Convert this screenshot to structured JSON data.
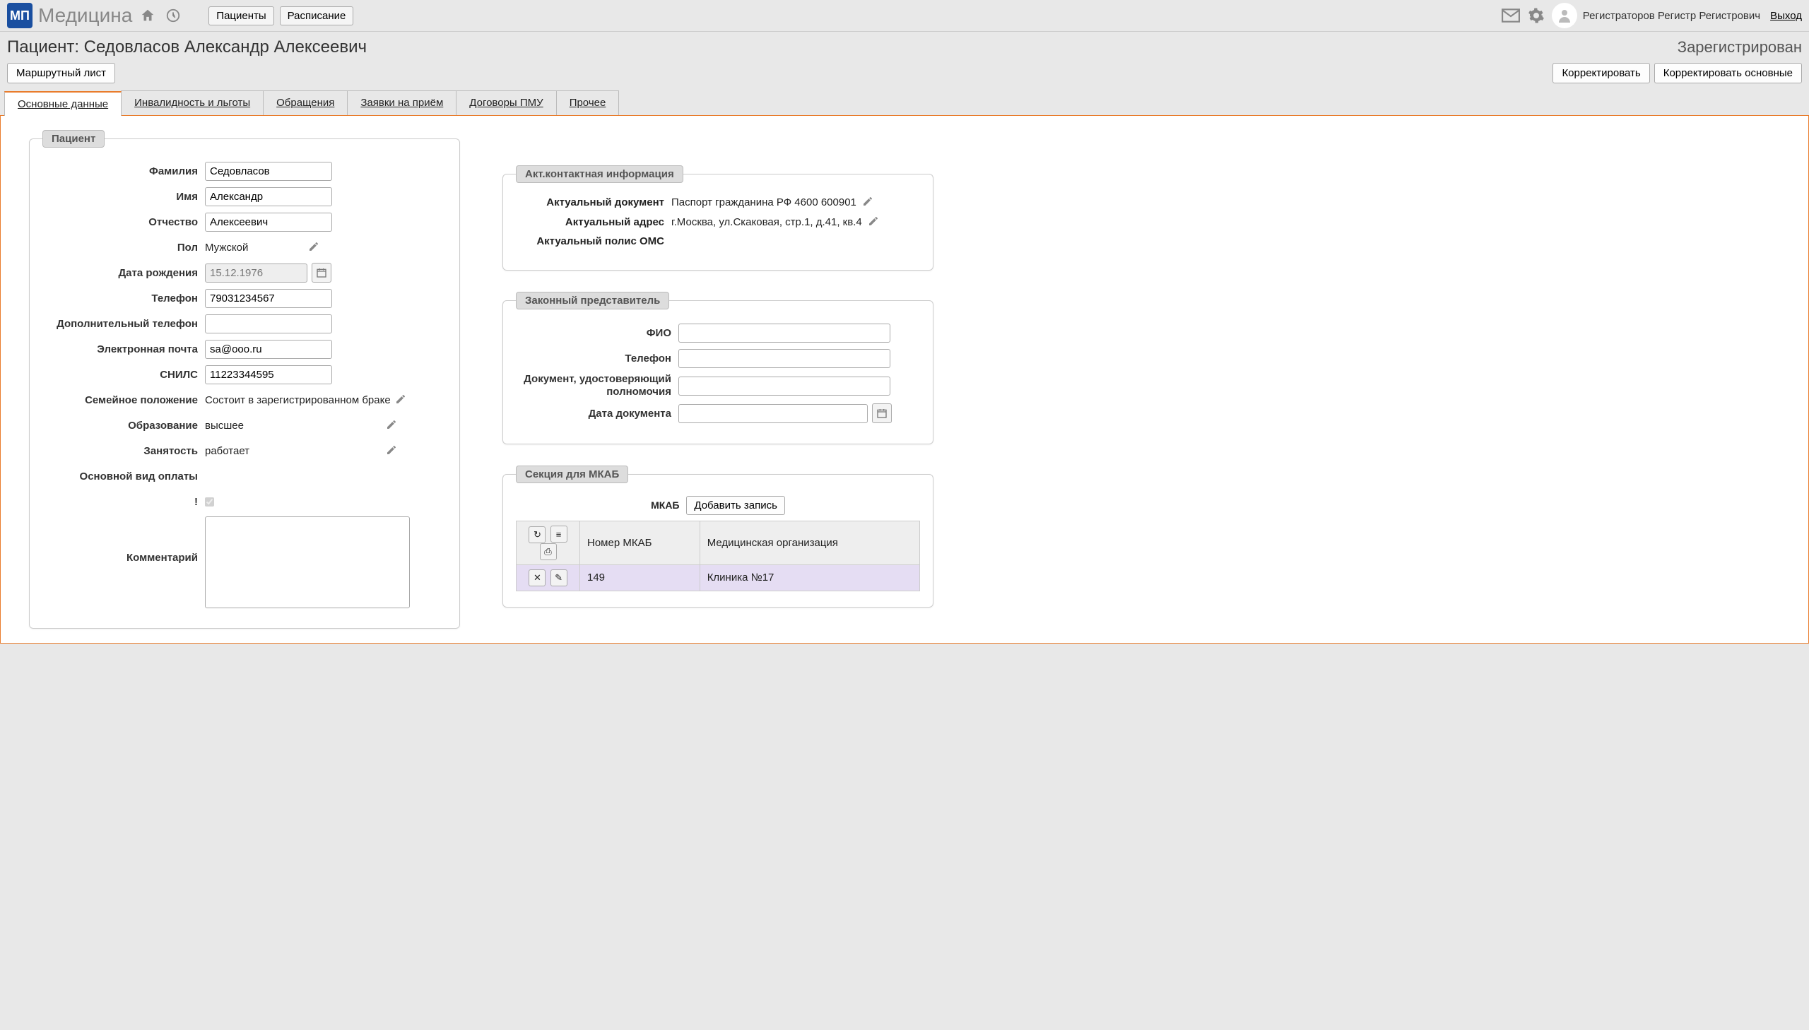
{
  "topbar": {
    "logo_text": "МП",
    "app_title": "Медицина",
    "nav_patients": "Пациенты",
    "nav_schedule": "Расписание",
    "username": "Регистраторов Регистр Регистрович",
    "logout": "Выход"
  },
  "header": {
    "page_title": "Пациент: Седовласов Александр Алексеевич",
    "status": "Зарегистрирован",
    "route_sheet_btn": "Маршрутный лист",
    "edit_btn": "Корректировать",
    "edit_main_btn": "Корректировать основные"
  },
  "tabs": {
    "t0": "Основные данные",
    "t1": "Инвалидность и льготы",
    "t2": "Обращения",
    "t3": "Заявки на приём",
    "t4": "Договоры ПМУ",
    "t5": "Прочее"
  },
  "patient_section": {
    "legend": "Пациент",
    "labels": {
      "lastname": "Фамилия",
      "firstname": "Имя",
      "patronymic": "Отчество",
      "sex": "Пол",
      "dob": "Дата рождения",
      "phone": "Телефон",
      "phone2": "Дополнительный телефон",
      "email": "Электронная почта",
      "snils": "СНИЛС",
      "marital": "Семейное положение",
      "education": "Образование",
      "employment": "Занятость",
      "payment": "Основной вид оплаты",
      "excl": "!",
      "comment": "Комментарий"
    },
    "values": {
      "lastname": "Седовласов",
      "firstname": "Александр",
      "patronymic": "Алексеевич",
      "sex": "Мужской",
      "dob": "15.12.1976",
      "phone": "79031234567",
      "phone2": "",
      "email": "sa@ooo.ru",
      "snils": "11223344595",
      "marital": "Состоит в зарегистрированном браке",
      "education": "высшее",
      "employment": "работает",
      "payment": "",
      "comment": ""
    }
  },
  "contact_section": {
    "legend": "Акт.контактная информация",
    "labels": {
      "doc": "Актуальный документ",
      "addr": "Актуальный адрес",
      "oms": "Актуальный полис ОМС"
    },
    "values": {
      "doc": "Паспорт гражданина РФ 4600 600901",
      "addr": "г.Москва, ул.Скаковая, стр.1, д.41, кв.4",
      "oms": ""
    }
  },
  "rep_section": {
    "legend": "Законный представитель",
    "labels": {
      "fio": "ФИО",
      "phone": "Телефон",
      "doc": "Документ, удостоверяющий полномочия",
      "date": "Дата документа"
    },
    "values": {
      "fio": "",
      "phone": "",
      "doc": "",
      "date": ""
    }
  },
  "mkab_section": {
    "legend": "Секция для МКАБ",
    "label": "МКАБ",
    "add_btn": "Добавить запись",
    "col_number": "Номер МКАБ",
    "col_org": "Медицинская организация",
    "row_number": "149",
    "row_org": "Клиника №17"
  }
}
